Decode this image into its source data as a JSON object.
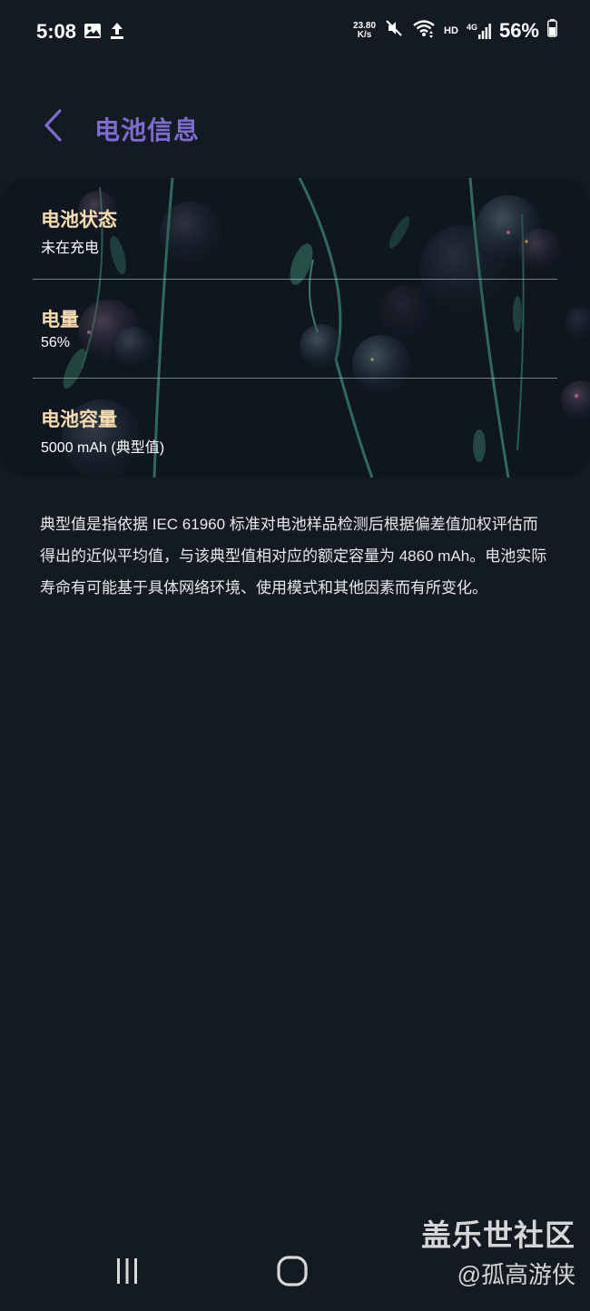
{
  "status_bar": {
    "time": "5:08",
    "net_speed_value": "23.80",
    "net_speed_unit": "K/s",
    "hd": "HD",
    "network": "4G",
    "battery_percent": "56%",
    "icons": [
      "image-icon",
      "upload-icon",
      "mute-icon",
      "wifi-icon",
      "signal-icon",
      "battery-icon"
    ]
  },
  "header": {
    "title": "电池信息",
    "back_icon": "chevron-left-icon"
  },
  "card": {
    "items": [
      {
        "label": "电池状态",
        "value": "未在充电"
      },
      {
        "label": "电量",
        "value": "56%"
      },
      {
        "label": "电池容量",
        "value": "5000 mAh (典型值)"
      }
    ]
  },
  "description": "典型值是指依据 IEC 61960 标准对电池样品检测后根据偏差值加权评估而得出的近似平均值，与该典型值相对应的额定容量为 4860 mAh。电池实际寿命有可能基于具体网络环境、使用模式和其他因素而有所变化。",
  "watermark": {
    "title": "盖乐世社区",
    "sub": "@孤高游侠"
  },
  "nav_bar": {
    "icons": [
      "recents-icon",
      "home-icon"
    ]
  },
  "colors": {
    "background": "#131a22",
    "title_accent": "#7d6ccc",
    "label": "#f5ddb0"
  }
}
